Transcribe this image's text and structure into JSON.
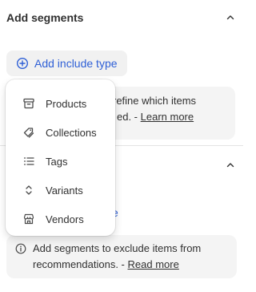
{
  "segments": {
    "title": "Add segments",
    "add_include_label": "Add include type",
    "include_info": {
      "line1_tail": "refine which items",
      "line2_tail": "ed. -",
      "link": "Learn more"
    },
    "exclude_partial_link": "e",
    "exclude_info": {
      "text": "Add segments to exclude items from recommendations. -",
      "link": "Read more"
    }
  },
  "menu": {
    "items": [
      {
        "label": "Products",
        "icon": "archive-icon"
      },
      {
        "label": "Collections",
        "icon": "tag-pair-icon"
      },
      {
        "label": "Tags",
        "icon": "list-icon"
      },
      {
        "label": "Variants",
        "icon": "chevron-up-down-icon"
      },
      {
        "label": "Vendors",
        "icon": "store-icon"
      }
    ]
  },
  "colors": {
    "accent": "#2e5fd6",
    "text": "#303030",
    "surface": "#f4f4f4"
  }
}
